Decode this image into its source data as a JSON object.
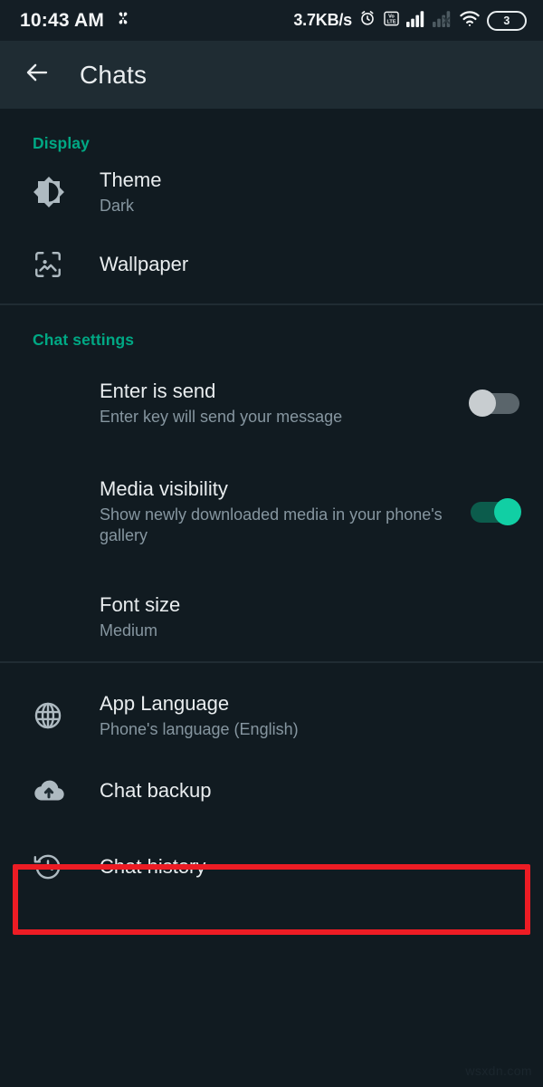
{
  "status_bar": {
    "time": "10:43 AM",
    "left_icon": "pinwheel-icon",
    "network_speed": "3.7KB/s",
    "icons": [
      "alarm-icon",
      "volte-icon",
      "signal-bars-icon",
      "signal-no-service-icon",
      "wifi-icon"
    ],
    "battery_label": "3"
  },
  "app_bar": {
    "back_label": "back-arrow",
    "title": "Chats"
  },
  "sections": [
    {
      "header": "Display",
      "rows": [
        {
          "icon": "brightness-icon",
          "primary": "Theme",
          "secondary": "Dark"
        },
        {
          "icon": "image-icon",
          "primary": "Wallpaper",
          "secondary": ""
        }
      ]
    },
    {
      "header": "Chat settings",
      "rows": [
        {
          "icon": "",
          "primary": "Enter is send",
          "secondary": "Enter key will send your message",
          "toggle": "off"
        },
        {
          "icon": "",
          "primary": "Media visibility",
          "secondary": "Show newly downloaded media in your phone's gallery",
          "toggle": "on"
        },
        {
          "icon": "",
          "primary": "Font size",
          "secondary": "Medium"
        }
      ]
    },
    {
      "header": "",
      "rows": [
        {
          "icon": "globe-icon",
          "primary": "App Language",
          "secondary": "Phone's language (English)"
        },
        {
          "icon": "cloud-upload-icon",
          "primary": "Chat backup",
          "secondary": "",
          "highlighted": true
        },
        {
          "icon": "history-icon",
          "primary": "Chat history",
          "secondary": ""
        }
      ]
    }
  ],
  "colors": {
    "background": "#111b21",
    "app_bar": "#1f2c33",
    "status_bar": "#141e25",
    "accent_green": "#00a884",
    "toggle_on": "#11cfa4",
    "toggle_off": "#c8cdd0",
    "highlight": "#ed1c24",
    "primary_text": "#e9edef",
    "secondary_text": "#8696a0"
  },
  "watermark": "wsxdn.com"
}
